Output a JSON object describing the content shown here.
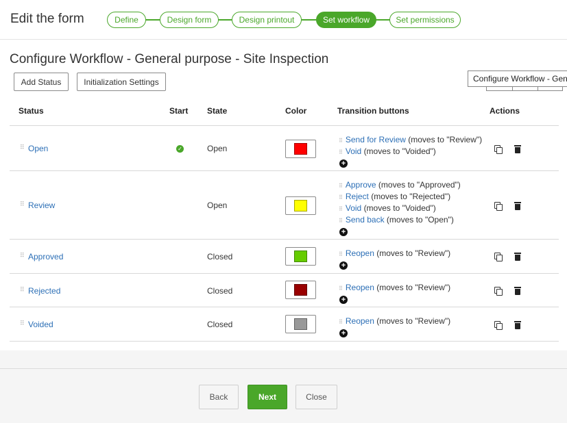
{
  "header": {
    "title": "Edit the form",
    "steps": [
      {
        "label": "Define",
        "active": false
      },
      {
        "label": "Design form",
        "active": false
      },
      {
        "label": "Design printout",
        "active": false
      },
      {
        "label": "Set workflow",
        "active": true
      },
      {
        "label": "Set permissions",
        "active": false
      }
    ]
  },
  "main": {
    "title": "Configure Workflow - General purpose - Site Inspection",
    "add_status_label": "Add Status",
    "init_settings_label": "Initialization Settings",
    "tooltip": "Configure Workflow - General purpose - Site Inspection",
    "columns": {
      "status": "Status",
      "start": "Start",
      "state": "State",
      "color": "Color",
      "transitions": "Transition buttons",
      "actions": "Actions"
    },
    "rows": [
      {
        "status": "Open",
        "start": true,
        "state": "Open",
        "color": "#ff0000",
        "transitions": [
          {
            "label": "Send for Review",
            "desc": "(moves to \"Review\")"
          },
          {
            "label": "Void",
            "desc": "(moves to \"Voided\")"
          }
        ]
      },
      {
        "status": "Review",
        "start": false,
        "state": "Open",
        "color": "#ffff00",
        "transitions": [
          {
            "label": "Approve",
            "desc": "(moves to \"Approved\")"
          },
          {
            "label": "Reject",
            "desc": "(moves to \"Rejected\")"
          },
          {
            "label": "Void",
            "desc": "(moves to \"Voided\")"
          },
          {
            "label": "Send back",
            "desc": "(moves to \"Open\")"
          }
        ]
      },
      {
        "status": "Approved",
        "start": false,
        "state": "Closed",
        "color": "#66cc00",
        "transitions": [
          {
            "label": "Reopen",
            "desc": "(moves to \"Review\")"
          }
        ]
      },
      {
        "status": "Rejected",
        "start": false,
        "state": "Closed",
        "color": "#990000",
        "transitions": [
          {
            "label": "Reopen",
            "desc": "(moves to \"Review\")"
          }
        ]
      },
      {
        "status": "Voided",
        "start": false,
        "state": "Closed",
        "color": "#999999",
        "transitions": [
          {
            "label": "Reopen",
            "desc": "(moves to \"Review\")"
          }
        ]
      }
    ]
  },
  "footer": {
    "back_label": "Back",
    "next_label": "Next",
    "close_label": "Close"
  },
  "colors": {
    "accent": "#4aa72a",
    "link": "#2c6fb6"
  }
}
